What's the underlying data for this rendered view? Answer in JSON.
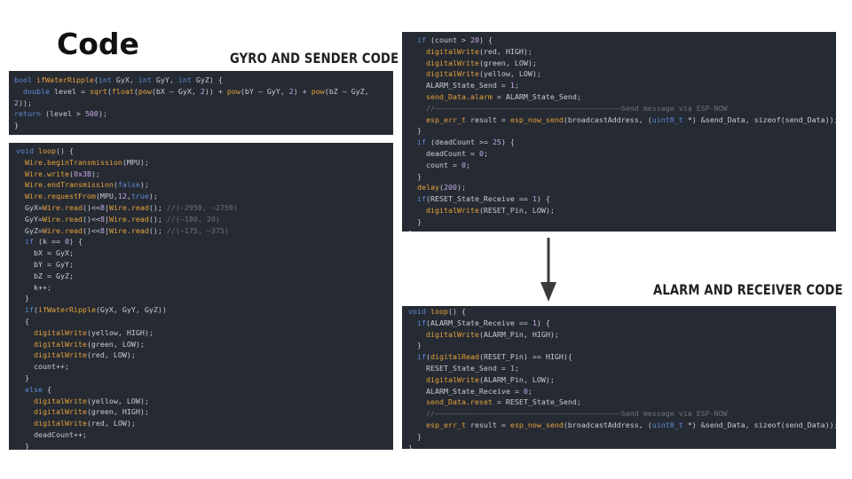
{
  "slide": {
    "title": "Code",
    "gyro_label": "GYRO AND SENDER CODE",
    "alarm_label": "ALARM AND RECEIVER CODE"
  },
  "colors": {
    "background": "#ffffff",
    "code_background": "#262a33",
    "keyword": "#5b8bd6",
    "function": "#e4a339",
    "number": "#c6a8e8",
    "comment": "#6b717c",
    "text": "#c9ccd2",
    "arrow": "#3a3a3a"
  },
  "icons": {
    "arrow": "arrow-down-icon"
  },
  "code": {
    "ripple": [
      [
        [
          "k",
          "bool "
        ],
        [
          "f",
          "ifWaterRipple"
        ],
        [
          "t",
          "("
        ],
        [
          "k",
          "int "
        ],
        [
          "t",
          "GyX, "
        ],
        [
          "k",
          "int "
        ],
        [
          "t",
          "GyY, "
        ],
        [
          "k",
          "int "
        ],
        [
          "t",
          "GyZ) {"
        ]
      ],
      [
        [
          "t",
          "  "
        ],
        [
          "k",
          "double "
        ],
        [
          "t",
          "level = "
        ],
        [
          "f",
          "sqrt"
        ],
        [
          "t",
          "("
        ],
        [
          "f",
          "float"
        ],
        [
          "t",
          "("
        ],
        [
          "f",
          "pow"
        ],
        [
          "t",
          "(bX – GyX, "
        ],
        [
          "n",
          "2"
        ],
        [
          "t",
          ")) + "
        ],
        [
          "f",
          "pow"
        ],
        [
          "t",
          "(bY – GyY, "
        ],
        [
          "n",
          "2"
        ],
        [
          "t",
          ") + "
        ],
        [
          "f",
          "pow"
        ],
        [
          "t",
          "(bZ – GyZ,"
        ]
      ],
      [
        [
          "n",
          "2"
        ],
        [
          "t",
          "));"
        ]
      ],
      [
        [
          "k",
          "return "
        ],
        [
          "t",
          "(level > "
        ],
        [
          "n",
          "500"
        ],
        [
          "t",
          ");"
        ]
      ],
      [
        [
          "t",
          "}"
        ]
      ]
    ],
    "loop_sender": [
      [
        [
          "k",
          "void "
        ],
        [
          "f",
          "loop"
        ],
        [
          "t",
          "() {"
        ]
      ],
      [
        [
          "t",
          "  "
        ],
        [
          "f",
          "Wire.beginTransmission"
        ],
        [
          "t",
          "(MPU);"
        ]
      ],
      [
        [
          "t",
          "  "
        ],
        [
          "f",
          "Wire.write"
        ],
        [
          "t",
          "("
        ],
        [
          "n",
          "0x3B"
        ],
        [
          "t",
          ");"
        ]
      ],
      [
        [
          "t",
          "  "
        ],
        [
          "f",
          "Wire.endTransmission"
        ],
        [
          "t",
          "("
        ],
        [
          "k",
          "false"
        ],
        [
          "t",
          ");"
        ]
      ],
      [
        [
          "t",
          "  "
        ],
        [
          "f",
          "Wire.requestFrom"
        ],
        [
          "t",
          "(MPU,"
        ],
        [
          "n",
          "12"
        ],
        [
          "t",
          ","
        ],
        [
          "k",
          "true"
        ],
        [
          "t",
          ");"
        ]
      ],
      [
        [
          "t",
          "  GyX="
        ],
        [
          "f",
          "Wire.read"
        ],
        [
          "t",
          "()<<"
        ],
        [
          "n",
          "8"
        ],
        [
          "t",
          "|"
        ],
        [
          "f",
          "Wire.read"
        ],
        [
          "t",
          "(); "
        ],
        [
          "c",
          "//(–2950, –2750)"
        ]
      ],
      [
        [
          "t",
          "  GyY="
        ],
        [
          "f",
          "Wire.read"
        ],
        [
          "t",
          "()<<"
        ],
        [
          "n",
          "8"
        ],
        [
          "t",
          "|"
        ],
        [
          "f",
          "Wire.read"
        ],
        [
          "t",
          "(); "
        ],
        [
          "c",
          "//(–180, 20)"
        ]
      ],
      [
        [
          "t",
          "  GyZ="
        ],
        [
          "f",
          "Wire.read"
        ],
        [
          "t",
          "()<<"
        ],
        [
          "n",
          "8"
        ],
        [
          "t",
          "|"
        ],
        [
          "f",
          "Wire.read"
        ],
        [
          "t",
          "(); "
        ],
        [
          "c",
          "//(–175, –375)"
        ]
      ],
      [
        [
          "t",
          "  "
        ],
        [
          "k",
          "if "
        ],
        [
          "t",
          "(k == "
        ],
        [
          "n",
          "0"
        ],
        [
          "t",
          ") {"
        ]
      ],
      [
        [
          "t",
          "    bX = GyX;"
        ]
      ],
      [
        [
          "t",
          "    bY = GyY;"
        ]
      ],
      [
        [
          "t",
          "    bZ = GyZ;"
        ]
      ],
      [
        [
          "t",
          "    k++;"
        ]
      ],
      [
        [
          "t",
          "  }"
        ]
      ],
      [
        [
          "t",
          "  "
        ],
        [
          "k",
          "if"
        ],
        [
          "t",
          "("
        ],
        [
          "f",
          "ifWaterRipple"
        ],
        [
          "t",
          "(GyX, GyY, GyZ))"
        ]
      ],
      [
        [
          "t",
          "  {"
        ]
      ],
      [
        [
          "t",
          "    "
        ],
        [
          "f",
          "digitalWrite"
        ],
        [
          "t",
          "(yellow, HIGH);"
        ]
      ],
      [
        [
          "t",
          "    "
        ],
        [
          "f",
          "digitalWrite"
        ],
        [
          "t",
          "(green, LOW);"
        ]
      ],
      [
        [
          "t",
          "    "
        ],
        [
          "f",
          "digitalWrite"
        ],
        [
          "t",
          "(red, LOW);"
        ]
      ],
      [
        [
          "t",
          "    count++;"
        ]
      ],
      [
        [
          "t",
          "  }"
        ]
      ],
      [
        [
          "t",
          "  "
        ],
        [
          "k",
          "else "
        ],
        [
          "t",
          "{"
        ]
      ],
      [
        [
          "t",
          "    "
        ],
        [
          "f",
          "digitalWrite"
        ],
        [
          "t",
          "(yellow, LOW);"
        ]
      ],
      [
        [
          "t",
          "    "
        ],
        [
          "f",
          "digitalWrite"
        ],
        [
          "t",
          "(green, HIGH);"
        ]
      ],
      [
        [
          "t",
          "    "
        ],
        [
          "f",
          "digitalWrite"
        ],
        [
          "t",
          "(red, LOW);"
        ]
      ],
      [
        [
          "t",
          "    deadCount++;"
        ]
      ],
      [
        [
          "t",
          "  }"
        ]
      ]
    ],
    "sender_alarm": [
      [
        [
          "t",
          "  "
        ],
        [
          "k",
          "if "
        ],
        [
          "t",
          "(count > "
        ],
        [
          "n",
          "20"
        ],
        [
          "t",
          ") {"
        ]
      ],
      [
        [
          "t",
          "    "
        ],
        [
          "f",
          "digitalWrite"
        ],
        [
          "t",
          "(red, HIGH);"
        ]
      ],
      [
        [
          "t",
          "    "
        ],
        [
          "f",
          "digitalWrite"
        ],
        [
          "t",
          "(green, LOW);"
        ]
      ],
      [
        [
          "t",
          "    "
        ],
        [
          "f",
          "digitalWrite"
        ],
        [
          "t",
          "(yellow, LOW);"
        ]
      ],
      [
        [
          "t",
          "    ALARM_State_Send = "
        ],
        [
          "n",
          "1"
        ],
        [
          "t",
          ";"
        ]
      ],
      [
        [
          "t",
          "    "
        ],
        [
          "f",
          "send_Data.alarm"
        ],
        [
          "t",
          " = ALARM_State_Send;"
        ]
      ],
      [
        [
          "t",
          "    "
        ],
        [
          "c",
          "//––––––––––––––––––––––––––––––––––––––––––Send message via ESP-NOW"
        ]
      ],
      [
        [
          "t",
          "    "
        ],
        [
          "f",
          "esp_err_t"
        ],
        [
          "t",
          " result = "
        ],
        [
          "f",
          "esp_now_send"
        ],
        [
          "t",
          "(broadcastAddress, ("
        ],
        [
          "k",
          "uint8_t"
        ],
        [
          "t",
          " *) &send_Data, sizeof(send_Data));"
        ]
      ],
      [
        [
          "t",
          "  }"
        ]
      ],
      [
        [
          "t",
          "  "
        ],
        [
          "k",
          "if "
        ],
        [
          "t",
          "(deadCount >= "
        ],
        [
          "n",
          "25"
        ],
        [
          "t",
          ") {"
        ]
      ],
      [
        [
          "t",
          "    deadCount = "
        ],
        [
          "n",
          "0"
        ],
        [
          "t",
          ";"
        ]
      ],
      [
        [
          "t",
          "    count = "
        ],
        [
          "n",
          "0"
        ],
        [
          "t",
          ";"
        ]
      ],
      [
        [
          "t",
          "  }"
        ]
      ],
      [
        [
          "t",
          "  "
        ],
        [
          "f",
          "delay"
        ],
        [
          "t",
          "("
        ],
        [
          "n",
          "200"
        ],
        [
          "t",
          ");"
        ]
      ],
      [
        [
          "t",
          "  "
        ],
        [
          "k",
          "if"
        ],
        [
          "t",
          "(RESET_State_Receive == "
        ],
        [
          "n",
          "1"
        ],
        [
          "t",
          ") {"
        ]
      ],
      [
        [
          "t",
          "    "
        ],
        [
          "f",
          "digitalWrite"
        ],
        [
          "t",
          "(RESET_Pin, LOW);"
        ]
      ],
      [
        [
          "t",
          "  }"
        ]
      ],
      [
        [
          "t",
          "}"
        ]
      ]
    ],
    "receiver_loop": [
      [
        [
          "k",
          "void "
        ],
        [
          "f",
          "loop"
        ],
        [
          "t",
          "() {"
        ]
      ],
      [
        [
          "t",
          "  "
        ],
        [
          "k",
          "if"
        ],
        [
          "t",
          "(ALARM_State_Receive == "
        ],
        [
          "n",
          "1"
        ],
        [
          "t",
          ") {"
        ]
      ],
      [
        [
          "t",
          "    "
        ],
        [
          "f",
          "digitalWrite"
        ],
        [
          "t",
          "(ALARM_Pin, HIGH);"
        ]
      ],
      [
        [
          "t",
          "  }"
        ]
      ],
      [
        [
          "t",
          "  "
        ],
        [
          "k",
          "if"
        ],
        [
          "t",
          "("
        ],
        [
          "f",
          "digitalRead"
        ],
        [
          "t",
          "(RESET_Pin) == HIGH){"
        ]
      ],
      [
        [
          "t",
          "    RESET_State_Send = "
        ],
        [
          "n",
          "1"
        ],
        [
          "t",
          ";"
        ]
      ],
      [
        [
          "t",
          "    "
        ],
        [
          "f",
          "digitalWrite"
        ],
        [
          "t",
          "(ALARM_Pin, LOW);"
        ]
      ],
      [
        [
          "t",
          "    ALARM_State_Receive = "
        ],
        [
          "n",
          "0"
        ],
        [
          "t",
          ";"
        ]
      ],
      [
        [
          "t",
          "    "
        ],
        [
          "f",
          "send_Data.reset"
        ],
        [
          "t",
          " = RESET_State_Send;"
        ]
      ],
      [
        [
          "t",
          "    "
        ],
        [
          "c",
          "//––––––––––––––––––––––––––––––––––––––––––Send message via ESP-NOW"
        ]
      ],
      [
        [
          "t",
          "    "
        ],
        [
          "f",
          "esp_err_t"
        ],
        [
          "t",
          " result = "
        ],
        [
          "f",
          "esp_now_send"
        ],
        [
          "t",
          "(broadcastAddress, ("
        ],
        [
          "k",
          "uint8_t"
        ],
        [
          "t",
          " *) &send_Data, sizeof(send_Data));"
        ]
      ],
      [
        [
          "t",
          "  }"
        ]
      ],
      [
        [
          "t",
          "}"
        ]
      ]
    ]
  }
}
